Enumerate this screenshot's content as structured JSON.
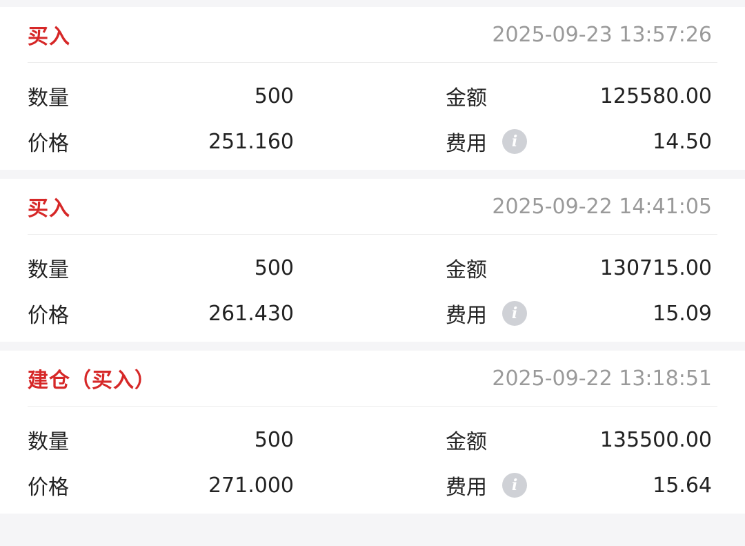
{
  "trades": [
    {
      "type": "买入",
      "time": "2025-09-23 13:57:26",
      "quantity_label": "数量",
      "quantity": "500",
      "amount_label": "金额",
      "amount": "125580.00",
      "price_label": "价格",
      "price": "251.160",
      "fee_label": "费用",
      "fee": "14.50",
      "fee_icon": "info-icon"
    },
    {
      "type": "买入",
      "time": "2025-09-22 14:41:05",
      "quantity_label": "数量",
      "quantity": "500",
      "amount_label": "金额",
      "amount": "130715.00",
      "price_label": "价格",
      "price": "261.430",
      "fee_label": "费用",
      "fee": "15.09",
      "fee_icon": "info-icon"
    },
    {
      "type": "建仓（买入）",
      "time": "2025-09-22 13:18:51",
      "quantity_label": "数量",
      "quantity": "500",
      "amount_label": "金额",
      "amount": "135500.00",
      "price_label": "价格",
      "price": "271.000",
      "fee_label": "费用",
      "fee": "15.64",
      "fee_icon": "info-icon"
    }
  ],
  "colors": {
    "buy": "#d62828",
    "timestamp": "#9a9a9a",
    "icon": "#cfd1d6"
  }
}
